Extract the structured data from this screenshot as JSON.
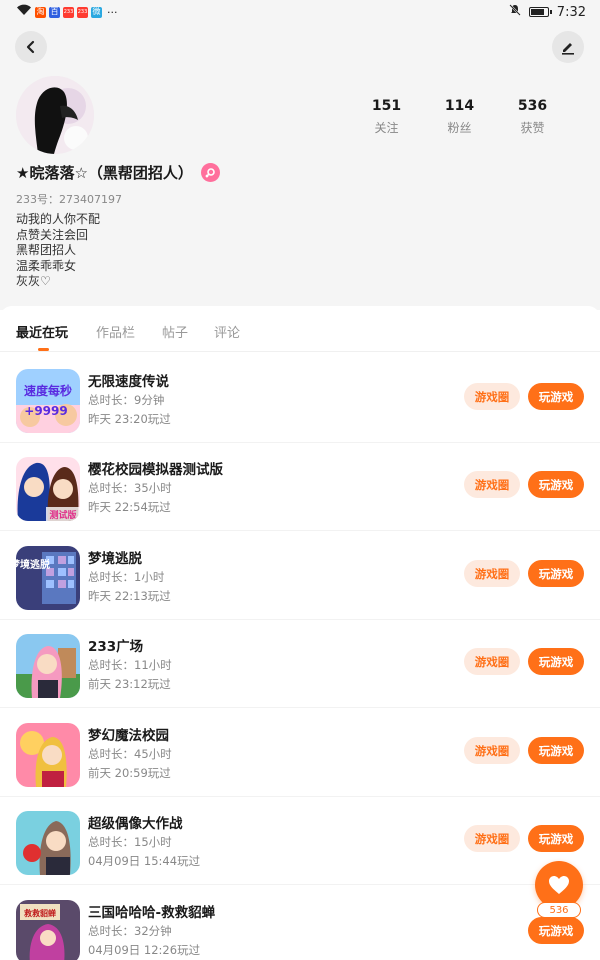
{
  "status_bar": {
    "time": "7:32",
    "more": "···",
    "apps": [
      {
        "glyph": "淘",
        "color": "#ff5000"
      },
      {
        "glyph": "百",
        "color": "#3060e0"
      },
      {
        "glyph": "233",
        "color": "#ff3b30"
      },
      {
        "glyph": "233",
        "color": "#ff3b30"
      },
      {
        "glyph": "微",
        "color": "#2aa8e0"
      }
    ]
  },
  "profile": {
    "username": "★晥落落☆（黑帮团招人）",
    "uid": "233号：273407197",
    "bio": [
      "动我的人你不配",
      "点赞关注会回",
      "黑帮团招人",
      "温柔乖乖女",
      "灰灰♡"
    ],
    "stats": [
      {
        "value": "151",
        "label": "关注"
      },
      {
        "value": "114",
        "label": "粉丝"
      },
      {
        "value": "536",
        "label": "获赞"
      }
    ]
  },
  "tabs": [
    "最近在玩",
    "作品栏",
    "帖子",
    "评论"
  ],
  "games": [
    {
      "name": "无限速度传说",
      "duration": "总时长：9分钟",
      "last_played": "昨天 23:20玩过",
      "icon_text_1": "速度每秒",
      "icon_text_2": "+9999"
    },
    {
      "name": "樱花校园模拟器测试版",
      "duration": "总时长：35小时",
      "last_played": "昨天 22:54玩过",
      "icon_text_1": "测试版",
      "icon_text_2": ""
    },
    {
      "name": "梦境逃脱",
      "duration": "总时长：1小时",
      "last_played": "昨天 22:13玩过",
      "icon_text_1": "梦境逃脱",
      "icon_text_2": ""
    },
    {
      "name": "233广场",
      "duration": "总时长：11小时",
      "last_played": "前天 23:12玩过",
      "icon_text_1": "",
      "icon_text_2": ""
    },
    {
      "name": "梦幻魔法校园",
      "duration": "总时长：45小时",
      "last_played": "前天 20:59玩过",
      "icon_text_1": "",
      "icon_text_2": ""
    },
    {
      "name": "超级偶像大作战",
      "duration": "总时长：15小时",
      "last_played": "04月09日 15:44玩过",
      "icon_text_1": "",
      "icon_text_2": ""
    },
    {
      "name": "三国哈哈哈-救救貂蝉",
      "duration": "总时长：32分钟",
      "last_played": "04月09日 12:26玩过",
      "icon_text_1": "救救貂蝉",
      "icon_text_2": ""
    }
  ],
  "buttons": {
    "circle": "游戏圈",
    "play": "玩游戏"
  },
  "likes": {
    "count": "536"
  },
  "colors": {
    "accent": "#ff7018",
    "accent_light": "#fde9de",
    "gender": "#ff6f9c"
  }
}
